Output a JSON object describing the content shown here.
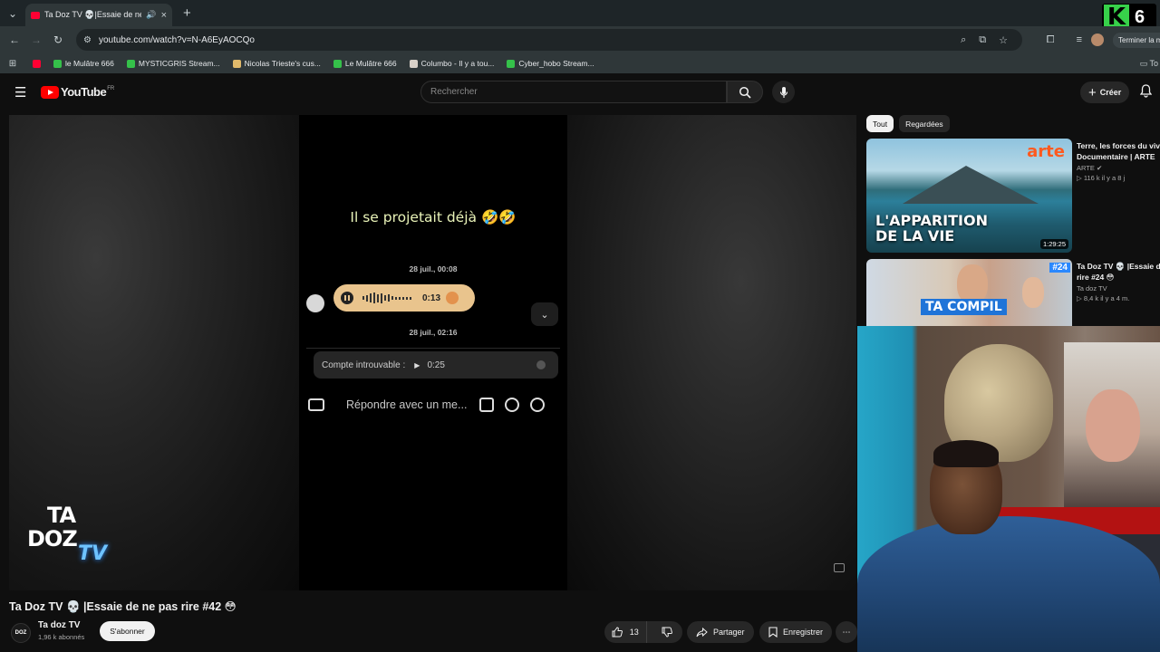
{
  "browser": {
    "tab_title": "Ta Doz TV 💀|Essaie de ne",
    "url": "youtube.com/watch?v=N-A6EyAOCQo",
    "profile_action": "Terminer la m",
    "bookmarks": [
      {
        "label": "le Mulâtre 666",
        "color": "#ff0033"
      },
      {
        "label": "MYSTICGRIS Stream...",
        "color": "#35c14a"
      },
      {
        "label": "Nicolas Trieste's cus...",
        "color": "#e0b96b"
      },
      {
        "label": "Le Mulâtre 666",
        "color": "#35c14a"
      },
      {
        "label": "Columbo - Il y a tou...",
        "color": "#d8d0c8"
      },
      {
        "label": "Cyber_hobo Stream...",
        "color": "#35c14a"
      }
    ],
    "bookmark_overflow": "To"
  },
  "kick_badge": {
    "letter": "K",
    "count": "6"
  },
  "youtube": {
    "logo_text": "YouTube",
    "logo_region": "FR",
    "search_placeholder": "Rechercher",
    "create_label": "Créer"
  },
  "video": {
    "caption": "Il se projetait déjà 🤣🤣",
    "timestamp_1": "28 juil., 00:08",
    "voice_duration": "0:13",
    "timestamp_2": "28 juil., 02:16",
    "quoted_label": "Compte introuvable :",
    "quoted_duration": "0:25",
    "reply_placeholder": "Répondre avec un me...",
    "watermark_line1": "TA",
    "watermark_line2": "DOZ",
    "watermark_tv": "TV"
  },
  "details": {
    "title": "Ta Doz TV 💀 |Essaie de ne pas rire #42 😳",
    "channel_name": "Ta doz TV",
    "channel_avatar": "DOZ",
    "subscribers": "1,96 k abonnés",
    "subscribe_label": "S'abonner",
    "likes": "13",
    "share_label": "Partager",
    "save_label": "Enregistrer"
  },
  "sidebar": {
    "chips": [
      "Tout",
      "Regardées"
    ],
    "recommendations": [
      {
        "title_line1": "Terre, les forces du vivant",
        "title_line2": "Documentaire | ARTE",
        "channel": "ARTE ✔",
        "meta": "▷ 116 k  il y a 8 j",
        "duration": "1:29:25",
        "thumb_text_1": "L'APPARITION",
        "thumb_text_2": "DE LA VIE",
        "thumb_brand": "arte"
      },
      {
        "title_line1": "Ta Doz TV 💀 |Essaie de",
        "title_line2": "rire #24 😳",
        "channel": "Ta doz TV",
        "meta": "▷ 8,4 k  il y a 4 m.",
        "thumb_text": "TA COMPIL",
        "thumb_badge": "#24"
      }
    ]
  }
}
